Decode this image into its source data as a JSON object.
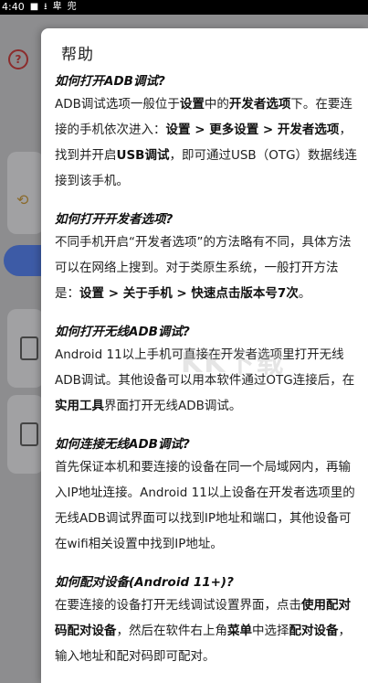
{
  "status_bar": {
    "time": "4:40"
  },
  "background": {
    "help_icon": "?",
    "history_icon": "history-icon"
  },
  "dialog": {
    "title": "帮助",
    "sections": [
      {
        "question": "如何打开ADB调试?",
        "answer_parts": [
          {
            "t": "ADB调试选项一般位于"
          },
          {
            "t": "设置",
            "b": true
          },
          {
            "t": "中的"
          },
          {
            "t": "开发者选项",
            "b": true
          },
          {
            "t": "下。在要连接的手机依次进入："
          },
          {
            "t": "设置 > 更多设置 > 开发者选项",
            "b": true
          },
          {
            "t": "，找到并开启"
          },
          {
            "t": "USB调试",
            "b": true
          },
          {
            "t": "，即可通过USB（OTG）数据线连接到该手机。"
          }
        ]
      },
      {
        "question": "如何打开开发者选项?",
        "answer_parts": [
          {
            "t": "不同手机开启“开发者选项”的方法略有不同，具体方法可以在网络上搜到。对于类原生系统，一般打开方法是："
          },
          {
            "t": "设置 > 关于手机 > 快速点击版本号7次",
            "b": true
          },
          {
            "t": "。"
          }
        ]
      },
      {
        "question": "如何打开无线ADB调试?",
        "answer_parts": [
          {
            "t": "Android 11以上手机可直接在开发者选项里打开无线ADB调试。其他设备可以用本软件通过OTG连接后，在"
          },
          {
            "t": "实用工具",
            "b": true
          },
          {
            "t": "界面打开无线ADB调试。"
          }
        ]
      },
      {
        "question": "如何连接无线ADB调试?",
        "answer_parts": [
          {
            "t": "首先保证本机和要连接的设备在同一个局域网内，再输入IP地址连接。Android 11以上设备在开发者选项里的无线ADB调试界面可以找到IP地址和端口，其他设备可在wifi相关设置中找到IP地址。"
          }
        ]
      },
      {
        "question": "如何配对设备(Android 11+)?",
        "answer_parts": [
          {
            "t": "在要连接的设备打开无线调试设置界面，点击"
          },
          {
            "t": "使用配对码配对设备",
            "b": true
          },
          {
            "t": "，然后在软件右上角"
          },
          {
            "t": "菜单",
            "b": true
          },
          {
            "t": "中选择"
          },
          {
            "t": "配对设备",
            "b": true
          },
          {
            "t": "，输入地址和配对码即可配对。"
          }
        ]
      }
    ]
  },
  "watermark": "KK下载"
}
